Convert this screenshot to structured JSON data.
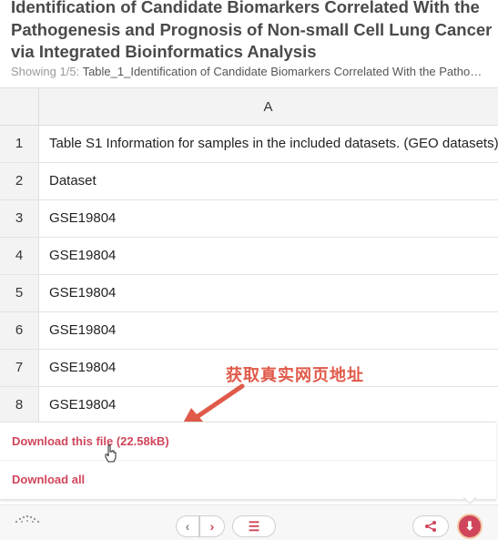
{
  "header": {
    "title": "Identification of Candidate Biomarkers Correlated With the Pathogenesis and Prognosis of Non-small Cell Lung Cancer via Integrated Bioinformatics Analysis",
    "showing_prefix": "Showing 1/5:",
    "showing_file": "Table_1_Identification of Candidate Biomarkers Correlated With the Patho…"
  },
  "sheet": {
    "column_header": "A",
    "rows": [
      {
        "num": "1",
        "value": "Table S1 Information for samples in the included datasets. (GEO datasets)"
      },
      {
        "num": "2",
        "value": "Dataset"
      },
      {
        "num": "3",
        "value": "GSE19804"
      },
      {
        "num": "4",
        "value": "GSE19804"
      },
      {
        "num": "5",
        "value": "GSE19804"
      },
      {
        "num": "6",
        "value": "GSE19804"
      },
      {
        "num": "7",
        "value": "GSE19804"
      },
      {
        "num": "8",
        "value": "GSE19804"
      }
    ]
  },
  "annotation": {
    "text": "获取真实网页地址",
    "color": "#e05a4a"
  },
  "download_menu": {
    "download_file": "Download this file (22.58kB)",
    "download_all": "Download all"
  },
  "toolbar": {
    "prev_icon": "‹",
    "next_icon": "›",
    "menu_icon": "☰",
    "share_icon": "share-icon",
    "download_icon": "⬇"
  },
  "colors": {
    "accent": "#d0455b",
    "header_gray": "#f3f3f3"
  }
}
